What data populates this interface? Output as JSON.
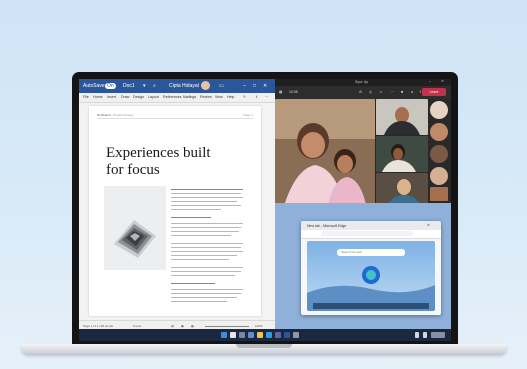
{
  "word": {
    "app_name": "AutoSave",
    "autosave_state": "On",
    "file_name": "Doc1",
    "user_name": "Cipta Hidayat",
    "tabs": [
      "File",
      "Home",
      "Insert",
      "Draw",
      "Design",
      "Layout",
      "References",
      "Mailings",
      "Review",
      "View",
      "Help"
    ],
    "doc_header_left": "Northwind",
    "doc_header_mid": "Product Design",
    "doc_header_right": "Page 1",
    "doc_title": "Experiences built for focus",
    "status_left": "Page 1 of 1   125 words",
    "status_focus": "Focus",
    "zoom": "100%"
  },
  "teams": {
    "title": "Sync Up",
    "timer": "10:35",
    "leave_label": "Leave"
  },
  "edge": {
    "tab_label": "New tab - Microsoft Edge",
    "search_placeholder": "Search the web"
  },
  "colors": {
    "word_blue": "#2b579a",
    "teams_dark": "#292929",
    "leave_red": "#c4314b",
    "taskbar": "#1c2740",
    "desktop_bg": "#cfe4f7"
  }
}
